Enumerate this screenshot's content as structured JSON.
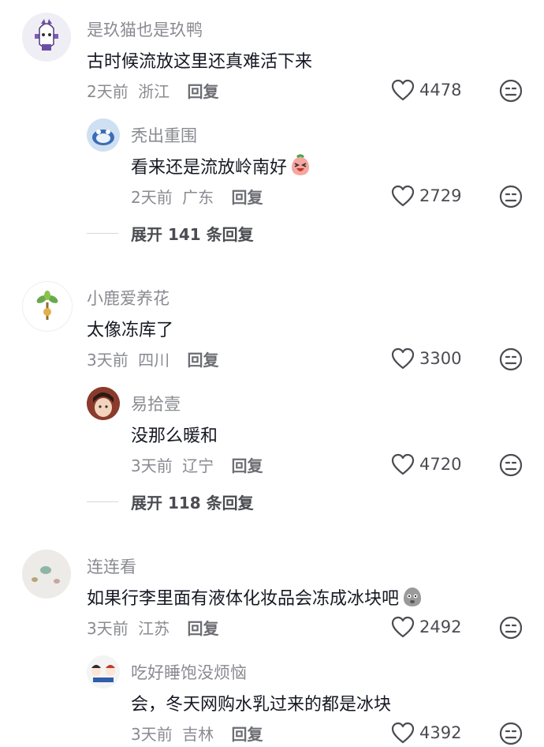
{
  "comments": [
    {
      "username": "是玖猫也是玖鸭",
      "text": "古时候流放这里还真难活下来",
      "time": "2天前",
      "location": "浙江",
      "reply_label": "回复",
      "likes": "4478",
      "reply": {
        "username": "秃出重围",
        "text": "看来还是流放岭南好",
        "time": "2天前",
        "location": "广东",
        "reply_label": "回复",
        "likes": "2729"
      },
      "expand_label": "展开 141 条回复"
    },
    {
      "username": "小鹿爱养花",
      "text": "太像冻库了",
      "time": "3天前",
      "location": "四川",
      "reply_label": "回复",
      "likes": "3300",
      "reply": {
        "username": "易拾壹",
        "text": "没那么暖和",
        "time": "3天前",
        "location": "辽宁",
        "reply_label": "回复",
        "likes": "4720"
      },
      "expand_label": "展开 118 条回复"
    },
    {
      "username": "连连看",
      "text": "如果行李里面有液体化妆品会冻成冰块吧",
      "time": "3天前",
      "location": "江苏",
      "reply_label": "回复",
      "likes": "2492",
      "reply": {
        "username": "吃好睡饱没烦恼",
        "text": "会，冬天网购水乳过来的都是冰块",
        "time": "3天前",
        "location": "吉林",
        "reply_label": "回复",
        "likes": "4392"
      }
    }
  ],
  "colors": {
    "username": "#8a8b91",
    "text": "#161823",
    "meta": "#8a8b91"
  }
}
